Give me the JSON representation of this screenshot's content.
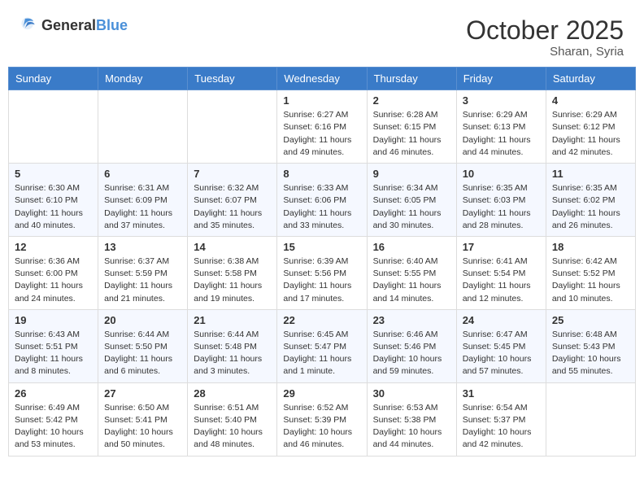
{
  "header": {
    "logo_general": "General",
    "logo_blue": "Blue",
    "month": "October 2025",
    "location": "Sharan, Syria"
  },
  "days_of_week": [
    "Sunday",
    "Monday",
    "Tuesday",
    "Wednesday",
    "Thursday",
    "Friday",
    "Saturday"
  ],
  "weeks": [
    [
      {
        "day": "",
        "sunrise": "",
        "sunset": "",
        "daylight": ""
      },
      {
        "day": "",
        "sunrise": "",
        "sunset": "",
        "daylight": ""
      },
      {
        "day": "",
        "sunrise": "",
        "sunset": "",
        "daylight": ""
      },
      {
        "day": "1",
        "sunrise": "Sunrise: 6:27 AM",
        "sunset": "Sunset: 6:16 PM",
        "daylight": "Daylight: 11 hours and 49 minutes."
      },
      {
        "day": "2",
        "sunrise": "Sunrise: 6:28 AM",
        "sunset": "Sunset: 6:15 PM",
        "daylight": "Daylight: 11 hours and 46 minutes."
      },
      {
        "day": "3",
        "sunrise": "Sunrise: 6:29 AM",
        "sunset": "Sunset: 6:13 PM",
        "daylight": "Daylight: 11 hours and 44 minutes."
      },
      {
        "day": "4",
        "sunrise": "Sunrise: 6:29 AM",
        "sunset": "Sunset: 6:12 PM",
        "daylight": "Daylight: 11 hours and 42 minutes."
      }
    ],
    [
      {
        "day": "5",
        "sunrise": "Sunrise: 6:30 AM",
        "sunset": "Sunset: 6:10 PM",
        "daylight": "Daylight: 11 hours and 40 minutes."
      },
      {
        "day": "6",
        "sunrise": "Sunrise: 6:31 AM",
        "sunset": "Sunset: 6:09 PM",
        "daylight": "Daylight: 11 hours and 37 minutes."
      },
      {
        "day": "7",
        "sunrise": "Sunrise: 6:32 AM",
        "sunset": "Sunset: 6:07 PM",
        "daylight": "Daylight: 11 hours and 35 minutes."
      },
      {
        "day": "8",
        "sunrise": "Sunrise: 6:33 AM",
        "sunset": "Sunset: 6:06 PM",
        "daylight": "Daylight: 11 hours and 33 minutes."
      },
      {
        "day": "9",
        "sunrise": "Sunrise: 6:34 AM",
        "sunset": "Sunset: 6:05 PM",
        "daylight": "Daylight: 11 hours and 30 minutes."
      },
      {
        "day": "10",
        "sunrise": "Sunrise: 6:35 AM",
        "sunset": "Sunset: 6:03 PM",
        "daylight": "Daylight: 11 hours and 28 minutes."
      },
      {
        "day": "11",
        "sunrise": "Sunrise: 6:35 AM",
        "sunset": "Sunset: 6:02 PM",
        "daylight": "Daylight: 11 hours and 26 minutes."
      }
    ],
    [
      {
        "day": "12",
        "sunrise": "Sunrise: 6:36 AM",
        "sunset": "Sunset: 6:00 PM",
        "daylight": "Daylight: 11 hours and 24 minutes."
      },
      {
        "day": "13",
        "sunrise": "Sunrise: 6:37 AM",
        "sunset": "Sunset: 5:59 PM",
        "daylight": "Daylight: 11 hours and 21 minutes."
      },
      {
        "day": "14",
        "sunrise": "Sunrise: 6:38 AM",
        "sunset": "Sunset: 5:58 PM",
        "daylight": "Daylight: 11 hours and 19 minutes."
      },
      {
        "day": "15",
        "sunrise": "Sunrise: 6:39 AM",
        "sunset": "Sunset: 5:56 PM",
        "daylight": "Daylight: 11 hours and 17 minutes."
      },
      {
        "day": "16",
        "sunrise": "Sunrise: 6:40 AM",
        "sunset": "Sunset: 5:55 PM",
        "daylight": "Daylight: 11 hours and 14 minutes."
      },
      {
        "day": "17",
        "sunrise": "Sunrise: 6:41 AM",
        "sunset": "Sunset: 5:54 PM",
        "daylight": "Daylight: 11 hours and 12 minutes."
      },
      {
        "day": "18",
        "sunrise": "Sunrise: 6:42 AM",
        "sunset": "Sunset: 5:52 PM",
        "daylight": "Daylight: 11 hours and 10 minutes."
      }
    ],
    [
      {
        "day": "19",
        "sunrise": "Sunrise: 6:43 AM",
        "sunset": "Sunset: 5:51 PM",
        "daylight": "Daylight: 11 hours and 8 minutes."
      },
      {
        "day": "20",
        "sunrise": "Sunrise: 6:44 AM",
        "sunset": "Sunset: 5:50 PM",
        "daylight": "Daylight: 11 hours and 6 minutes."
      },
      {
        "day": "21",
        "sunrise": "Sunrise: 6:44 AM",
        "sunset": "Sunset: 5:48 PM",
        "daylight": "Daylight: 11 hours and 3 minutes."
      },
      {
        "day": "22",
        "sunrise": "Sunrise: 6:45 AM",
        "sunset": "Sunset: 5:47 PM",
        "daylight": "Daylight: 11 hours and 1 minute."
      },
      {
        "day": "23",
        "sunrise": "Sunrise: 6:46 AM",
        "sunset": "Sunset: 5:46 PM",
        "daylight": "Daylight: 10 hours and 59 minutes."
      },
      {
        "day": "24",
        "sunrise": "Sunrise: 6:47 AM",
        "sunset": "Sunset: 5:45 PM",
        "daylight": "Daylight: 10 hours and 57 minutes."
      },
      {
        "day": "25",
        "sunrise": "Sunrise: 6:48 AM",
        "sunset": "Sunset: 5:43 PM",
        "daylight": "Daylight: 10 hours and 55 minutes."
      }
    ],
    [
      {
        "day": "26",
        "sunrise": "Sunrise: 6:49 AM",
        "sunset": "Sunset: 5:42 PM",
        "daylight": "Daylight: 10 hours and 53 minutes."
      },
      {
        "day": "27",
        "sunrise": "Sunrise: 6:50 AM",
        "sunset": "Sunset: 5:41 PM",
        "daylight": "Daylight: 10 hours and 50 minutes."
      },
      {
        "day": "28",
        "sunrise": "Sunrise: 6:51 AM",
        "sunset": "Sunset: 5:40 PM",
        "daylight": "Daylight: 10 hours and 48 minutes."
      },
      {
        "day": "29",
        "sunrise": "Sunrise: 6:52 AM",
        "sunset": "Sunset: 5:39 PM",
        "daylight": "Daylight: 10 hours and 46 minutes."
      },
      {
        "day": "30",
        "sunrise": "Sunrise: 6:53 AM",
        "sunset": "Sunset: 5:38 PM",
        "daylight": "Daylight: 10 hours and 44 minutes."
      },
      {
        "day": "31",
        "sunrise": "Sunrise: 6:54 AM",
        "sunset": "Sunset: 5:37 PM",
        "daylight": "Daylight: 10 hours and 42 minutes."
      },
      {
        "day": "",
        "sunrise": "",
        "sunset": "",
        "daylight": ""
      }
    ]
  ]
}
